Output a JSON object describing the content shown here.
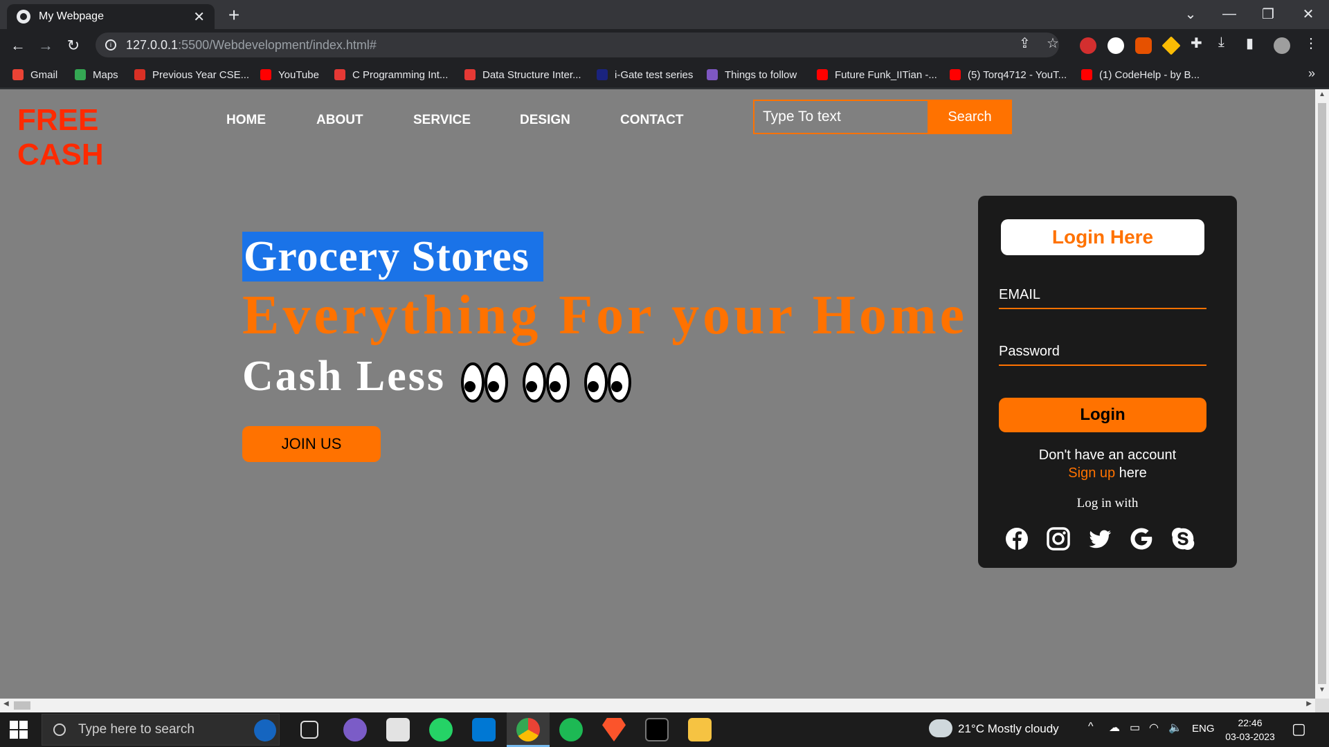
{
  "browser": {
    "tab_title": "My Webpage",
    "tab_close": "✕",
    "new_tab": "+",
    "url_host": "127.0.0.1",
    "url_path": ":5500/Webdevelopment/index.html#",
    "win_minimize": "—",
    "win_restore": "❐",
    "win_close": "✕",
    "tab_search": "⌄",
    "back": "←",
    "forward": "→",
    "reload": "↻",
    "bookmarks": [
      {
        "label": "Gmail",
        "color": "#ea4335"
      },
      {
        "label": "Maps",
        "color": "#34a853"
      },
      {
        "label": "Previous Year CSE...",
        "color": "#d93025"
      },
      {
        "label": "YouTube",
        "color": "#ff0000"
      },
      {
        "label": "C Programming Int...",
        "color": "#e53935"
      },
      {
        "label": "Data Structure Inter...",
        "color": "#e53935"
      },
      {
        "label": "i-Gate test series",
        "color": "#1a237e"
      },
      {
        "label": "Things to follow",
        "color": "#7e57c2"
      },
      {
        "label": "Future Funk_IITian -...",
        "color": "#ff0000"
      },
      {
        "label": "(5) Torq4712 - YouT...",
        "color": "#ff0000"
      },
      {
        "label": "(1) CodeHelp - by B...",
        "color": "#ff0000"
      }
    ],
    "bookmarks_more": "»"
  },
  "site": {
    "logo": "FREE CASH",
    "nav": [
      "HOME",
      "ABOUT",
      "SERVICE",
      "DESIGN",
      "CONTACT"
    ],
    "search_placeholder": "Type To text",
    "search_button": "Search",
    "hero_line1": "Grocery Stores",
    "hero_line2": "Everything For your Home",
    "hero_line3": "Cash Less",
    "join_button": "JOIN US",
    "accent_color": "#ff7200"
  },
  "login": {
    "title": "Login Here",
    "email_label": "EMAIL",
    "password_label": "Password",
    "login_button": "Login",
    "no_account": "Don't have an account",
    "signup_link": "Sign up",
    "signup_suffix": " here",
    "login_with": "Log in with",
    "social": [
      "facebook-icon",
      "instagram-icon",
      "twitter-icon",
      "google-icon",
      "skype-icon"
    ]
  },
  "taskbar": {
    "search_placeholder": "Type here to search",
    "weather": "21°C  Mostly cloudy",
    "language": "ENG",
    "time": "22:46",
    "date": "03-03-2023"
  }
}
